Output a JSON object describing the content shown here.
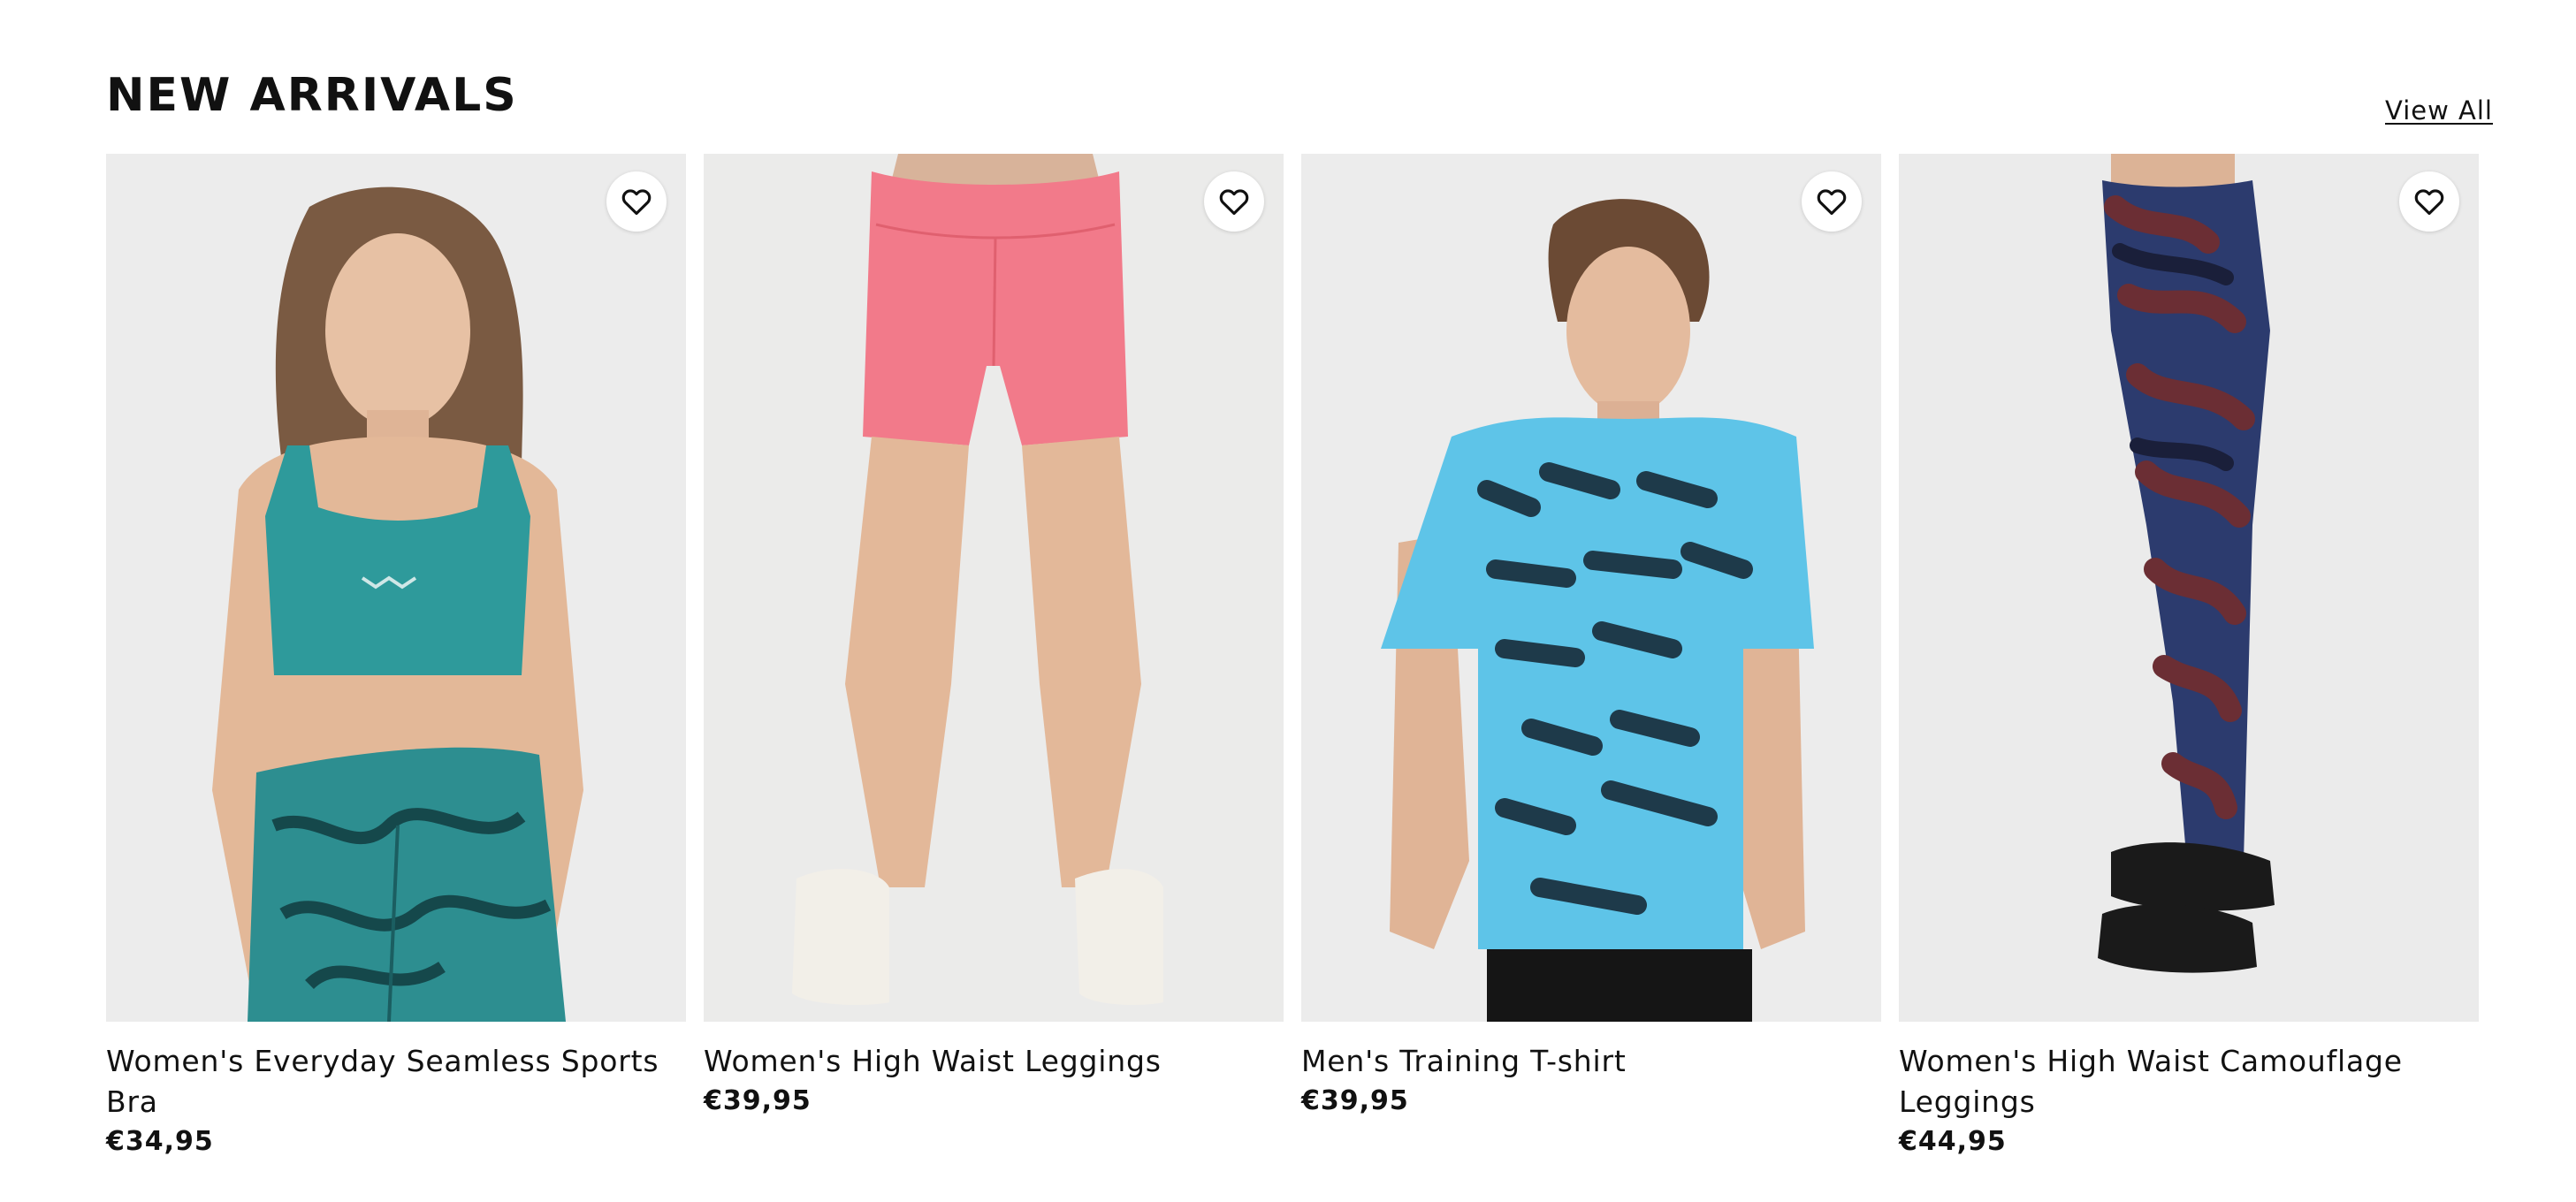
{
  "section": {
    "title": "NEW ARRIVALS",
    "view_all_label": "View All"
  },
  "products": [
    {
      "title": "Women's Everyday Seamless Sports Bra",
      "price": "€34,95",
      "wishlist_icon": "heart-outline-icon",
      "image_subject": "model-teal-sports-bra",
      "colors": {
        "primary": "#2e9a9b",
        "secondary": "#1b5e61"
      }
    },
    {
      "title": "Women's High Waist Leggings",
      "price": "€39,95",
      "wishlist_icon": "heart-outline-icon",
      "image_subject": "model-pink-shorts",
      "colors": {
        "primary": "#f27a8a",
        "secondary": "#e96478"
      }
    },
    {
      "title": "Men's Training T-shirt",
      "price": "€39,95",
      "wishlist_icon": "heart-outline-icon",
      "image_subject": "model-blue-tshirt",
      "colors": {
        "primary": "#5ec4e8",
        "secondary": "#1e3a4a"
      }
    },
    {
      "title": "Women's High Waist Camouflage Leggings",
      "price": "€44,95",
      "wishlist_icon": "heart-outline-icon",
      "image_subject": "model-camouflage-leggings",
      "colors": {
        "primary": "#2c3b6e",
        "secondary": "#6b2e34"
      }
    }
  ]
}
